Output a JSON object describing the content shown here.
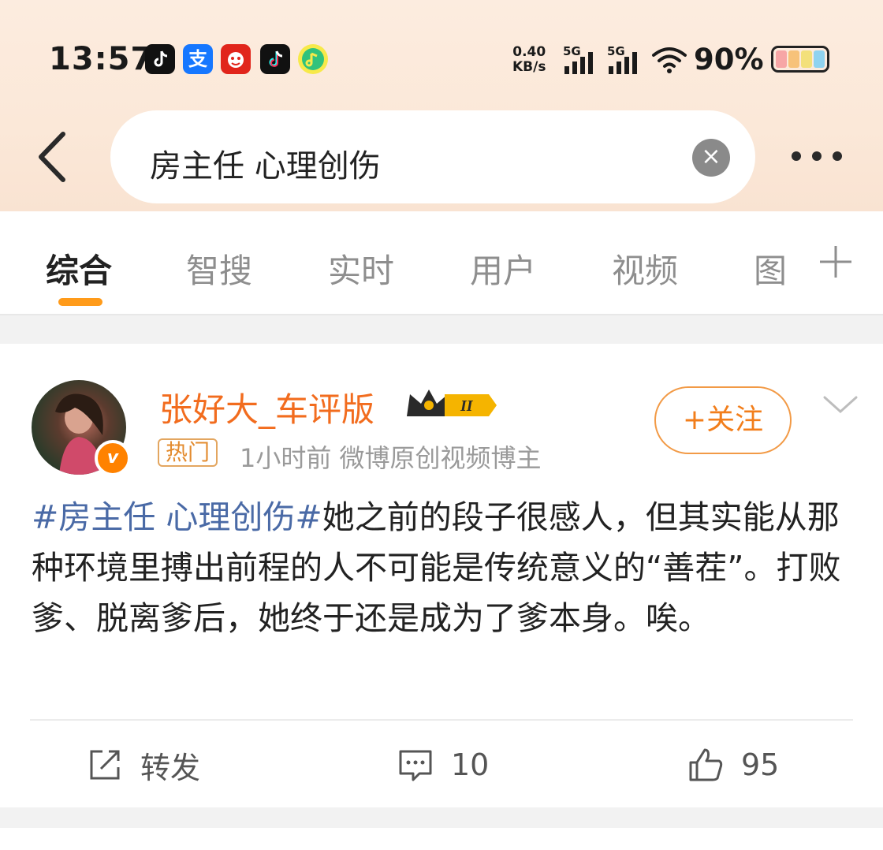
{
  "status_bar": {
    "time": "13:57",
    "apps": [
      "tiktok-icon",
      "alipay-icon",
      "jd-icon",
      "tiktok-icon",
      "qq-music-icon"
    ],
    "alipay_glyph": "支",
    "net_speed_value": "0.40",
    "net_speed_unit": "KB/s",
    "signal1_label": "5G",
    "signal2_label": "5G",
    "battery": "90%",
    "battery_level": 0.9
  },
  "header": {
    "search_query": "房主任 心理创伤",
    "clear_glyph": "×"
  },
  "tabs": [
    {
      "label": "综合",
      "active": true
    },
    {
      "label": "智搜"
    },
    {
      "label": "实时"
    },
    {
      "label": "用户"
    },
    {
      "label": "视频"
    },
    {
      "label": "图"
    }
  ],
  "post": {
    "username": "张好大_车评版",
    "level_badge": "II",
    "verified_glyph": "v",
    "hot_label": "热门",
    "meta": "1小时前  微博原创视频博主",
    "follow_label": "+关注",
    "hashtag": "#房主任 心理创伤#",
    "body": "她之前的段子很感人，但其实能从那种环境里搏出前程的人不可能是传统意义的“善茬”。打败爹、脱离爹后，她终于还是成为了爹本身。唉。",
    "repost_label": "转发",
    "comment_count": "10",
    "like_count": "95"
  },
  "colors": {
    "accent_orange": "#ff9b1a",
    "username": "#f26c1e",
    "hashtag": "#4a6aa6",
    "battery_segments": [
      "#f7a6a6",
      "#f7c27a",
      "#f3e07a",
      "#8fd3f0"
    ]
  }
}
